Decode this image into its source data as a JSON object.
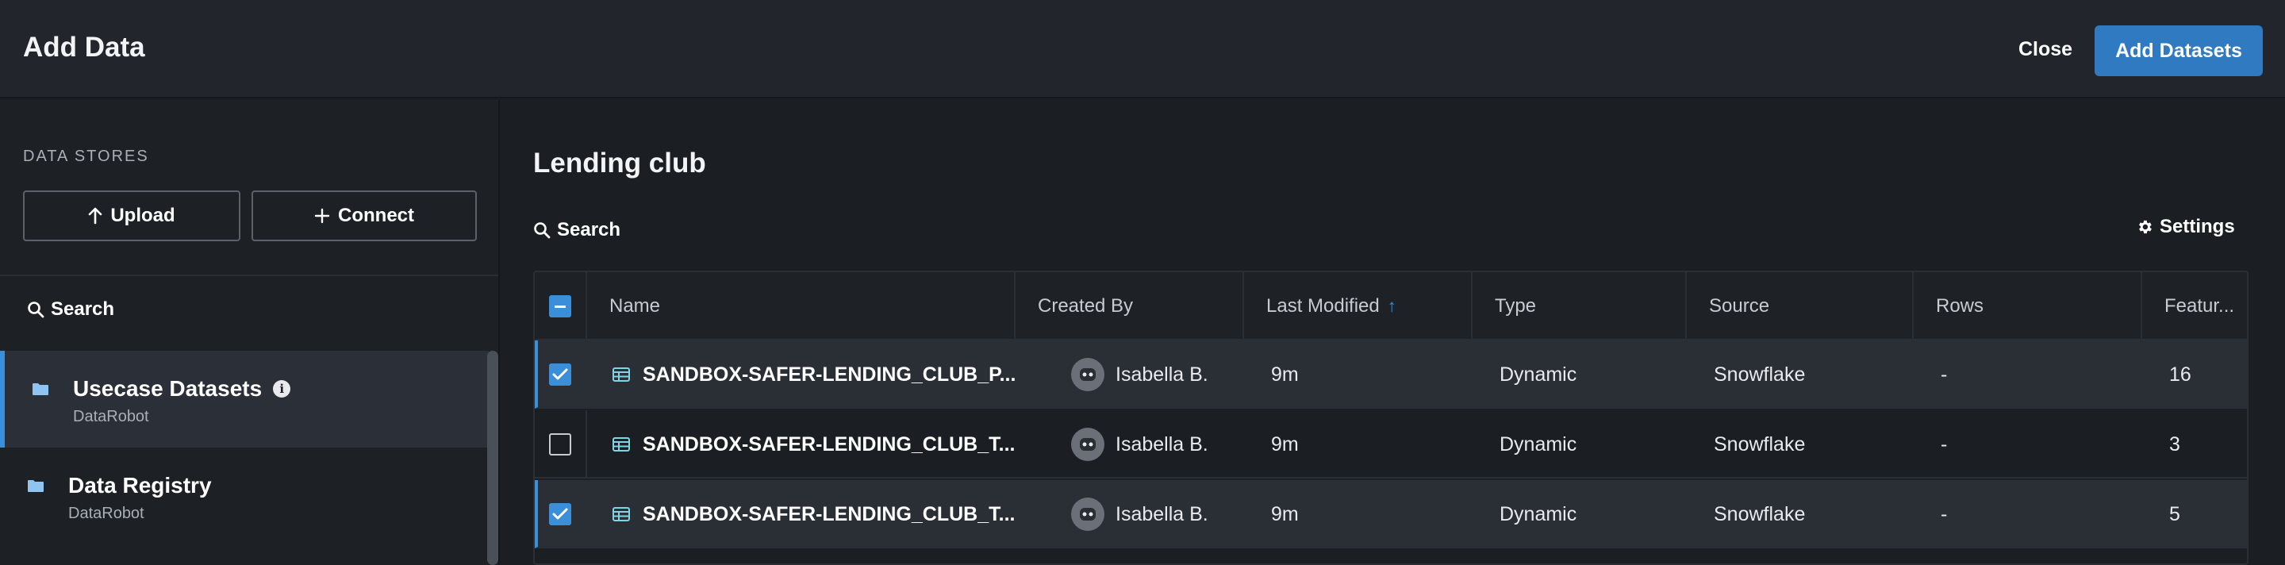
{
  "header": {
    "title": "Add Data",
    "close_label": "Close",
    "add_label": "Add Datasets"
  },
  "sidebar": {
    "section_label": "DATA STORES",
    "upload_label": "Upload",
    "connect_label": "Connect",
    "search_label": "Search",
    "items": [
      {
        "name": "Usecase Datasets",
        "sub": "DataRobot",
        "active": true,
        "icon": "folder-icon",
        "has_info": true
      },
      {
        "name": "Data Registry",
        "sub": "DataRobot",
        "active": false,
        "icon": "folder-icon",
        "has_info": false
      }
    ]
  },
  "main": {
    "title": "Lending club",
    "search_label": "Search",
    "settings_label": "Settings"
  },
  "table": {
    "columns": [
      "Name",
      "Created By",
      "Last Modified",
      "Type",
      "Source",
      "Rows",
      "Featur..."
    ],
    "sorted_column": "Last Modified",
    "sort_direction": "ascending",
    "header_checkbox": "partial",
    "rows": [
      {
        "checked": true,
        "name": "SANDBOX-SAFER-LENDING_CLUB_P...",
        "created_by": "Isabella B.",
        "last_modified": "9m",
        "type": "Dynamic",
        "source": "Snowflake",
        "rows": "-",
        "features": "16"
      },
      {
        "checked": false,
        "name": "SANDBOX-SAFER-LENDING_CLUB_T...",
        "created_by": "Isabella B.",
        "last_modified": "9m",
        "type": "Dynamic",
        "source": "Snowflake",
        "rows": "-",
        "features": "3"
      },
      {
        "checked": true,
        "name": "SANDBOX-SAFER-LENDING_CLUB_T...",
        "created_by": "Isabella B.",
        "last_modified": "9m",
        "type": "Dynamic",
        "source": "Snowflake",
        "rows": "-",
        "features": "5"
      }
    ]
  },
  "colors": {
    "accent": "#3b8fd9",
    "primary_button": "#2f7ac0",
    "background": "#1b1f24",
    "header_bg": "#22262c",
    "selected_row": "#2a2f36"
  }
}
